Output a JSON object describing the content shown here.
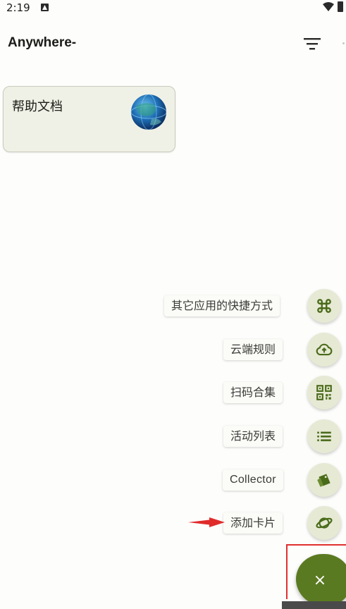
{
  "status_bar": {
    "time": "2:19",
    "notification_icon": "android-notification-icon",
    "wifi_icon": "wifi-icon",
    "battery_icon": "battery-icon"
  },
  "app_bar": {
    "title": "Anywhere-",
    "filter_icon": "filter-list-icon"
  },
  "cards": [
    {
      "title": "帮助文档",
      "icon": "globe-icon"
    }
  ],
  "fab_menu": {
    "items": [
      {
        "label": "其它应用的快捷方式",
        "icon": "command-key-icon"
      },
      {
        "label": "云端规则",
        "icon": "cloud-upload-icon"
      },
      {
        "label": "扫码合集",
        "icon": "qr-code-icon"
      },
      {
        "label": "活动列表",
        "icon": "list-icon"
      },
      {
        "label": "Collector",
        "icon": "collector-tag-icon"
      },
      {
        "label": "添加卡片",
        "icon": "planet-icon"
      }
    ],
    "main_fab_label": "×"
  },
  "colors": {
    "accent_green": "#5a7a21",
    "icon_green": "#4a6b1a",
    "mini_fab_bg": "#e6e9d4",
    "card_bg": "#f0f1e6",
    "highlight_red": "#e03030"
  }
}
